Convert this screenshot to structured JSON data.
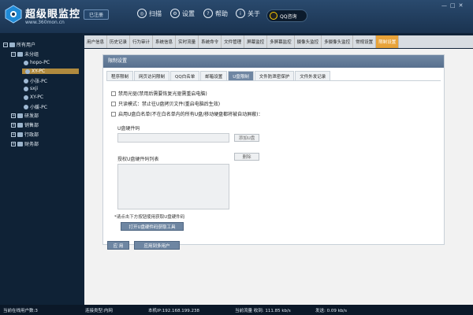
{
  "header": {
    "brand": "超级眼监控",
    "url": "www.360mon.cn",
    "reg_badge": "已注册",
    "nav": [
      {
        "label": "扫描",
        "icon": "scan-icon"
      },
      {
        "label": "设置",
        "icon": "gear-icon"
      },
      {
        "label": "帮助",
        "icon": "help-icon"
      },
      {
        "label": "关于",
        "icon": "info-icon"
      }
    ],
    "qq_label": "QQ咨询"
  },
  "tree": {
    "root": "所有用户",
    "group_unassigned": "未分组",
    "users": [
      "hopo-PC",
      "XY-PC",
      "小张-PC",
      "sxji",
      "XY-PC",
      "小媛-PC"
    ],
    "depts": [
      "研发部",
      "销售部",
      "行政部",
      "财务部"
    ]
  },
  "main_tabs": [
    "用户信息",
    "历史记录",
    "行为审计",
    "系统信息",
    "实时流量",
    "系统命令",
    "文件管理",
    "屏幕监控",
    "多屏幕监控",
    "摄像头监控",
    "多摄像头监控",
    "常规设置",
    "限制设置"
  ],
  "main_tab_active": 12,
  "panel": {
    "title": "限制设置",
    "sub_tabs": [
      "程序限制",
      "网页访问限制",
      "QQ白名单",
      "邮箱设置",
      "U盘限制",
      "文件防泄密保护",
      "文件外发记录"
    ],
    "sub_tab_active": 4,
    "options": [
      "禁用光驱(禁用后需要恢复光驱需重启电脑)",
      "只读模式：禁止往U盘拷贝文件(重启电脑后生效)",
      "启用U盘白名单(不在白名单内的所有U盘/移动硬盘都将被自动屏蔽)："
    ],
    "usb_code_label": "U盘硬件码",
    "add_button": "添加U盘",
    "delete_button": "删除",
    "auth_list_label": "授权U盘硬件码列表",
    "note": "*请点击下方按钮使用获取U盘硬件码",
    "tool_button": "打开U盘硬件码获取工具"
  },
  "bottom_buttons": {
    "apply": "应 用",
    "apply_multi": "应用到多用户"
  },
  "status": {
    "online": "当前在线用户数:3",
    "conn": "连接类型:内网",
    "ip": "本机IP:192.168.199.238",
    "traffic": "当前流量 收到: 111.85 kb/s",
    "sent": "发送: 0.09 kb/s"
  }
}
